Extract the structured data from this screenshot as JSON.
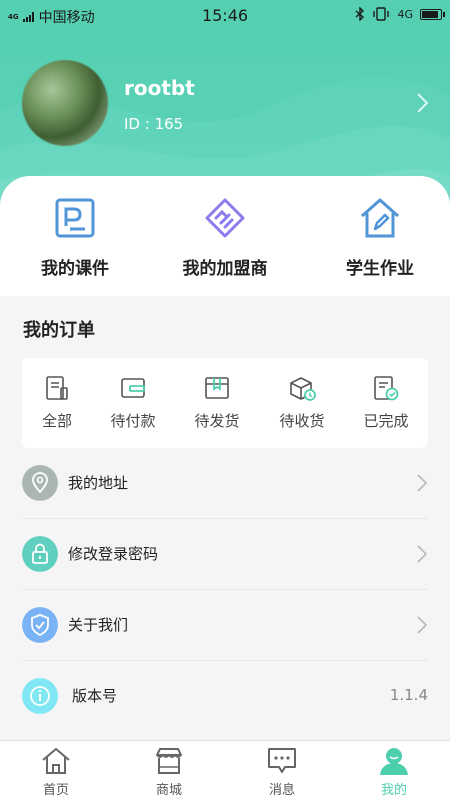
{
  "status_bar": {
    "network_type": "4G",
    "carrier": "中国移动",
    "time": "15:46",
    "data_type": "4G"
  },
  "profile": {
    "username": "rootbt",
    "user_id": "ID : 165"
  },
  "quick_actions": [
    {
      "label": "我的课件",
      "icon": "courseware-icon"
    },
    {
      "label": "我的加盟商",
      "icon": "handshake-icon"
    },
    {
      "label": "学生作业",
      "icon": "homework-icon"
    }
  ],
  "orders": {
    "title": "我的订单",
    "items": [
      {
        "label": "全部",
        "icon": "all-orders-icon"
      },
      {
        "label": "待付款",
        "icon": "wallet-icon"
      },
      {
        "label": "待发货",
        "icon": "package-icon"
      },
      {
        "label": "待收货",
        "icon": "delivery-box-icon"
      },
      {
        "label": "已完成",
        "icon": "completed-icon"
      }
    ]
  },
  "menu": [
    {
      "label": "我的地址",
      "icon": "location-icon",
      "color": "#a9b6b2"
    },
    {
      "label": "修改登录密码",
      "icon": "lock-icon",
      "color": "#5fd0c0"
    },
    {
      "label": "关于我们",
      "icon": "shield-icon",
      "color": "#7ab3f5"
    },
    {
      "label": "版本号",
      "icon": "info-icon",
      "color": "#7fe6f2",
      "value": "1.1.4"
    }
  ],
  "tabs": [
    {
      "label": "首页",
      "icon": "home-icon"
    },
    {
      "label": "商城",
      "icon": "store-icon"
    },
    {
      "label": "消息",
      "icon": "message-icon"
    },
    {
      "label": "我的",
      "icon": "profile-icon",
      "active": true
    }
  ],
  "colors": {
    "accent": "#4dcfae",
    "header": "#5fd3b9"
  }
}
